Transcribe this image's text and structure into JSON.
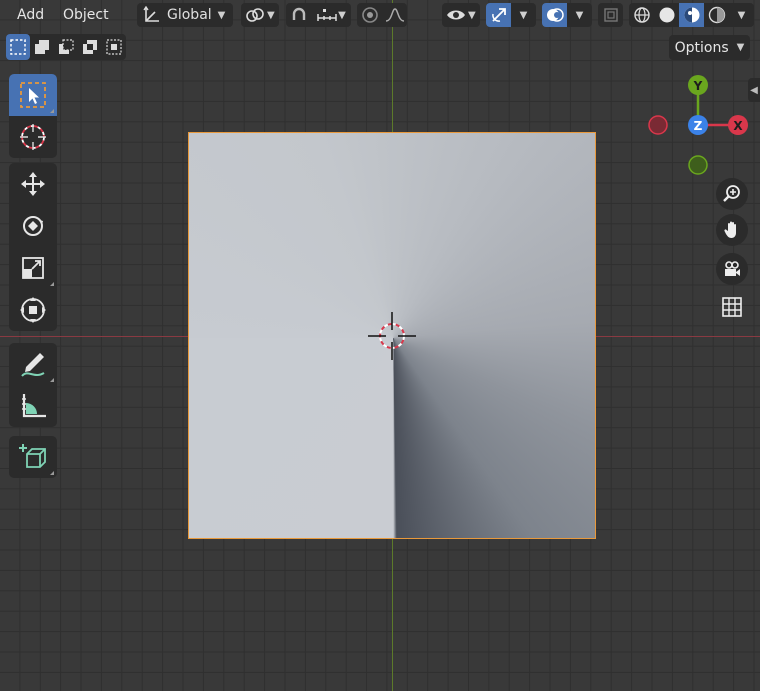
{
  "header": {
    "menus": [
      "Add",
      "Object"
    ],
    "transform_orientation": "Global"
  },
  "options": {
    "label": "Options"
  },
  "gizmo": {
    "y_label": "Y",
    "x_label": "X",
    "z_label": "Z"
  },
  "colors": {
    "selection_outline": "#e8993c",
    "active_button": "#4772b3",
    "x_axis": "#d9374b",
    "y_axis": "#6aa61e",
    "z_axis": "#3b82e8"
  },
  "toolbar": {
    "tools": [
      "select-box",
      "cursor",
      "move",
      "rotate",
      "scale",
      "transform",
      "annotate",
      "measure",
      "add-cube"
    ]
  }
}
